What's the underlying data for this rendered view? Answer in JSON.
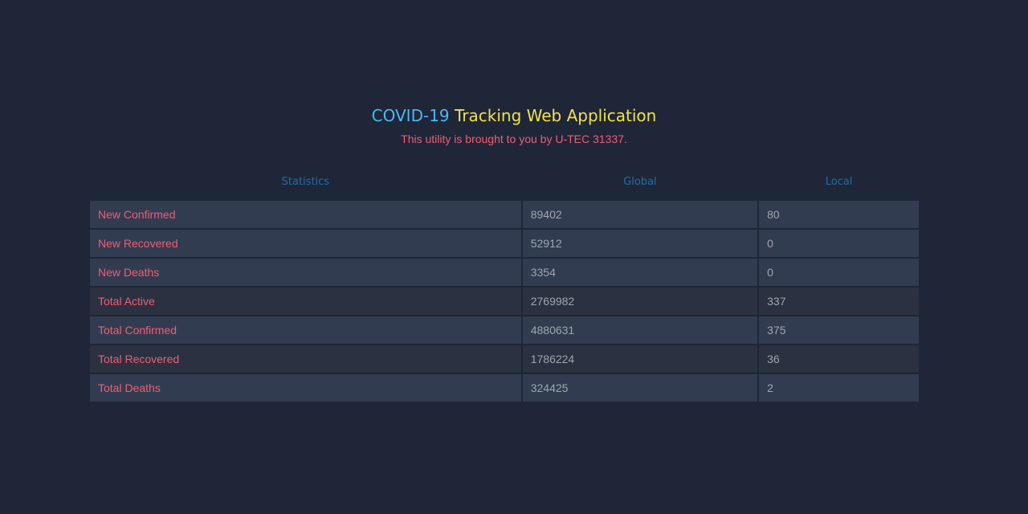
{
  "header": {
    "title_part1": "COVID-19",
    "title_part2": "Tracking Web Application",
    "subtitle": "This utility is brought to you by U-TEC 31337."
  },
  "table": {
    "columns": [
      "Statistics",
      "Global",
      "Local"
    ],
    "rows": [
      {
        "label": "New Confirmed",
        "global": "89402",
        "local": "80"
      },
      {
        "label": "New Recovered",
        "global": "52912",
        "local": "0"
      },
      {
        "label": "New Deaths",
        "global": "3354",
        "local": "0"
      },
      {
        "label": "Total Active",
        "global": "2769982",
        "local": "337"
      },
      {
        "label": "Total Confirmed",
        "global": "4880631",
        "local": "375"
      },
      {
        "label": "Total Recovered",
        "global": "1786224",
        "local": "36"
      },
      {
        "label": "Total Deaths",
        "global": "324425",
        "local": "2"
      }
    ]
  },
  "colors": {
    "background": "#1f2638",
    "title_accent": "#4db8f0",
    "title_main": "#f2e24a",
    "label_red": "#f25c73",
    "header_blue": "#1d6fa8"
  }
}
